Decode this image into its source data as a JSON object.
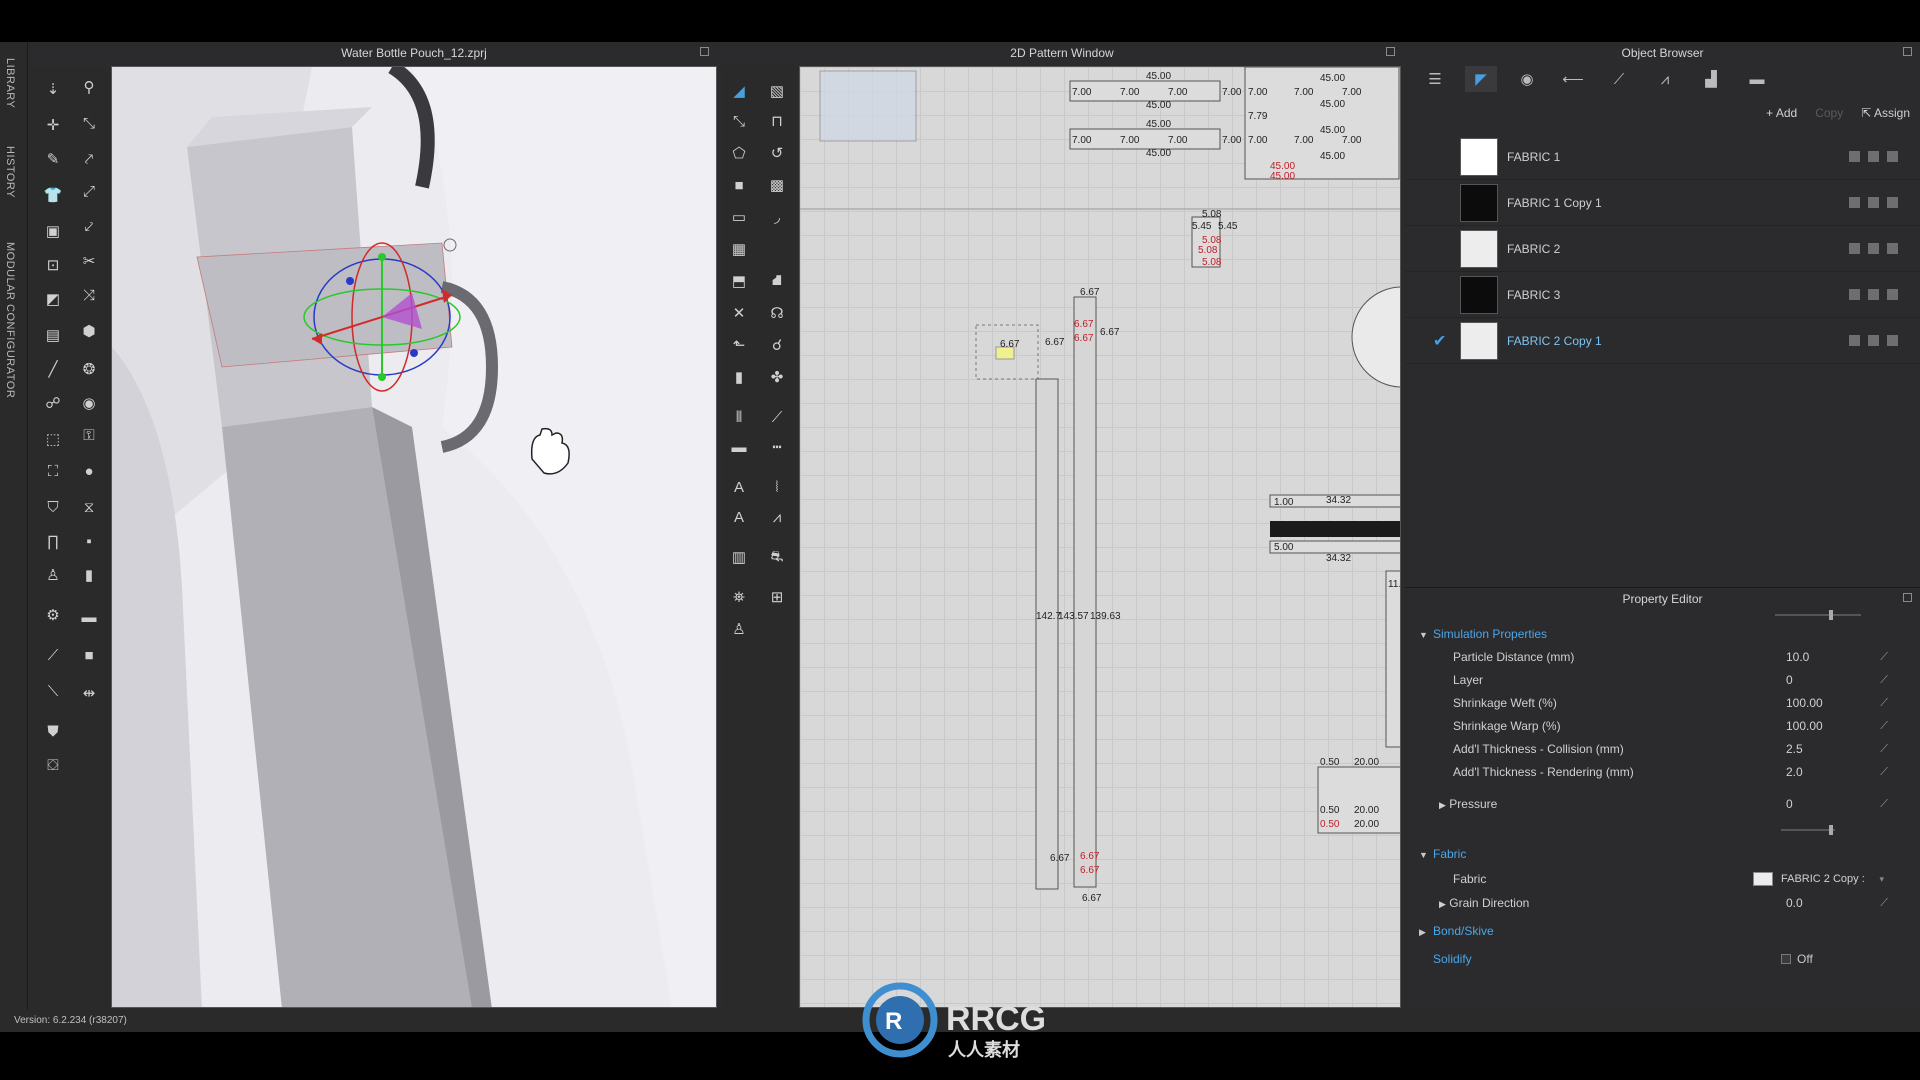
{
  "left_tabs": [
    "LIBRARY",
    "HISTORY",
    "MODULAR CONFIGURATOR"
  ],
  "panels": {
    "view3d_title": "Water Bottle Pouch_12.zprj",
    "view2d_title": "2D Pattern Window",
    "object_browser_title": "Object Browser",
    "property_editor_title": "Property Editor"
  },
  "object_browser": {
    "actions": {
      "add": "Add",
      "copy": "Copy",
      "assign": "Assign"
    },
    "fabrics": [
      {
        "name": "FABRIC 1",
        "swatch": "#ffffff",
        "selected": false
      },
      {
        "name": "FABRIC 1 Copy 1",
        "swatch": "#0c0c0c",
        "selected": false
      },
      {
        "name": "FABRIC 2",
        "swatch": "#ededed",
        "selected": false
      },
      {
        "name": "FABRIC 3",
        "swatch": "#0c0c0c",
        "selected": false
      },
      {
        "name": "FABRIC 2 Copy 1",
        "swatch": "#ededed",
        "selected": true
      }
    ]
  },
  "property_editor": {
    "simulation_section": "Simulation Properties",
    "rows": [
      {
        "label": "Particle Distance (mm)",
        "value": "10.0"
      },
      {
        "label": "Layer",
        "value": "0"
      },
      {
        "label": "Shrinkage Weft (%)",
        "value": "100.00"
      },
      {
        "label": "Shrinkage Warp (%)",
        "value": "100.00"
      },
      {
        "label": "Add'l Thickness - Collision (mm)",
        "value": "2.5"
      },
      {
        "label": "Add'l Thickness - Rendering (mm)",
        "value": "2.0"
      }
    ],
    "pressure": {
      "label": "Pressure",
      "value": "0"
    },
    "fabric_section": "Fabric",
    "fabric": {
      "label": "Fabric",
      "value": "FABRIC 2 Copy :"
    },
    "grain": {
      "label": "Grain Direction",
      "value": "0.0"
    },
    "bond_section": "Bond/Skive",
    "solidify_section": "Solidify",
    "solidify_value": "Off"
  },
  "pattern_labels": {
    "a": "45.00",
    "b": "7.00",
    "c": "7.79",
    "d": "5.08",
    "e": "5.45",
    "f": "6.67",
    "g": "142.7",
    "h": "143.57",
    "i": "139.63",
    "j": "1.00",
    "k": "34.32",
    "l": "5.00",
    "m": "0.50",
    "n": "20.00",
    "o": "11."
  },
  "status": {
    "version": "Version: 6.2.234 (r38207)"
  },
  "watermark": {
    "brand": "RRCG",
    "sub": "人人素材"
  },
  "colors": {
    "accent": "#46a0e0"
  }
}
